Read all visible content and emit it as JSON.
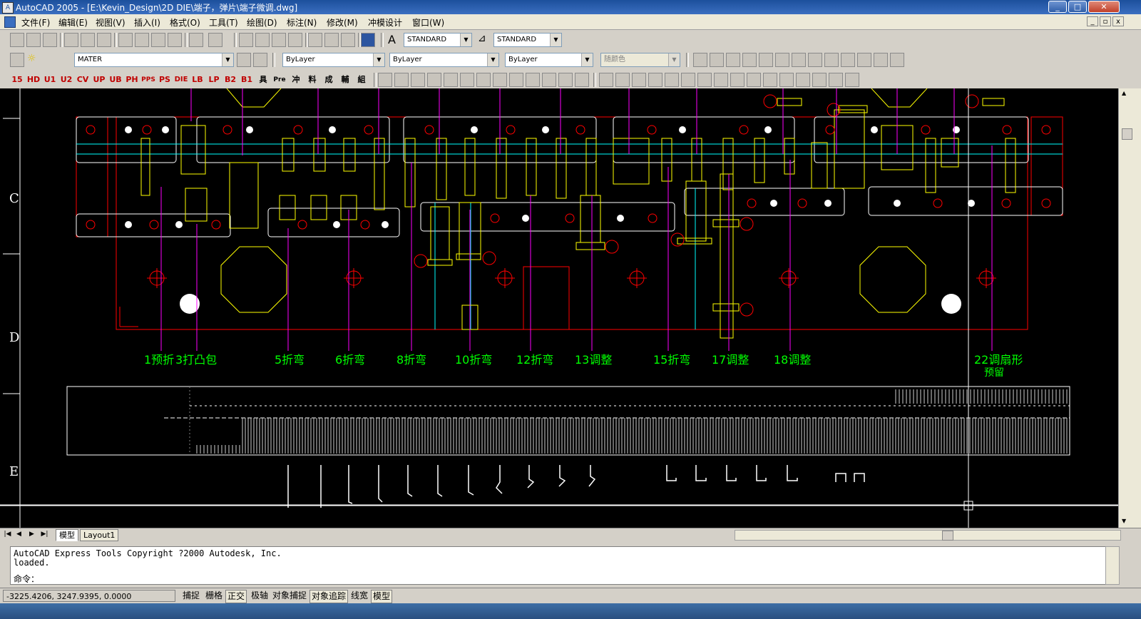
{
  "window": {
    "title": "AutoCAD 2005 - [E:\\Kevin_Design\\2D DIE\\端子，弹片\\端子微调.dwg]",
    "controls": [
      "minimize",
      "maximize",
      "close"
    ]
  },
  "menu": [
    "文件(F)",
    "编辑(E)",
    "视图(V)",
    "插入(I)",
    "格式(O)",
    "工具(T)",
    "绘图(D)",
    "标注(N)",
    "修改(M)",
    "冲模设计",
    "窗口(W)"
  ],
  "toolbar1": {
    "text_style": "STANDARD",
    "dim_style": "STANDARD",
    "icons": [
      "new-icon",
      "open-icon",
      "save-icon",
      "print-icon",
      "preview-icon",
      "publish-icon",
      "cut-icon",
      "copy-icon",
      "paste-icon",
      "match-prop-icon",
      "undo-icon",
      "redo-icon",
      "pan-icon",
      "zoom-realtime-icon",
      "zoom-window-icon",
      "zoom-previous-icon",
      "properties-icon",
      "design-center-icon",
      "tool-palette-icon",
      "help-icon"
    ]
  },
  "toolbar2": {
    "layer": "MATER",
    "color": "ByLayer",
    "linetype": "ByLayer",
    "lineweight": "ByLayer",
    "plotstyle": "随颜色"
  },
  "toolbar3": {
    "die_buttons": [
      "15",
      "HD",
      "U1",
      "U2",
      "CV",
      "UP",
      "UB",
      "PH",
      "PPS",
      "PS",
      "DIE",
      "LB",
      "LP",
      "B2",
      "B1",
      "具",
      "Pre",
      "冲",
      "料",
      "成",
      "輔",
      "組"
    ]
  },
  "drawing": {
    "row_labels": [
      "C",
      "D",
      "E"
    ],
    "station_labels": [
      "1预折",
      "3打凸包",
      "5折弯",
      "6折弯",
      "8折弯",
      "10折弯",
      "12折弯",
      "13调整",
      "15折弯",
      "17调整",
      "18调整",
      "22调扇形"
    ],
    "station_note": "预留",
    "colors": {
      "background": "#000000",
      "plate_outline": "#ffffff",
      "border_red": "#ff0000",
      "insert_yellow": "#ffff00",
      "arrow_magenta": "#ff00ff",
      "center_cyan": "#00ffff",
      "label_green": "#00ff00"
    }
  },
  "tabs": [
    "模型",
    "Layout1"
  ],
  "command": {
    "history": [
      "AutoCAD Express Tools Copyright ?2000 Autodesk, Inc.",
      "loaded."
    ],
    "prompt": "命令："
  },
  "status": {
    "coords": "-3225.4206, 3247.9395, 0.0000",
    "buttons": [
      "捕捉",
      "栅格",
      "正交",
      "极轴",
      "对象捕捉",
      "对象追踪",
      "线宽",
      "模型"
    ],
    "active": [
      "正交",
      "对象追踪",
      "模型"
    ]
  }
}
